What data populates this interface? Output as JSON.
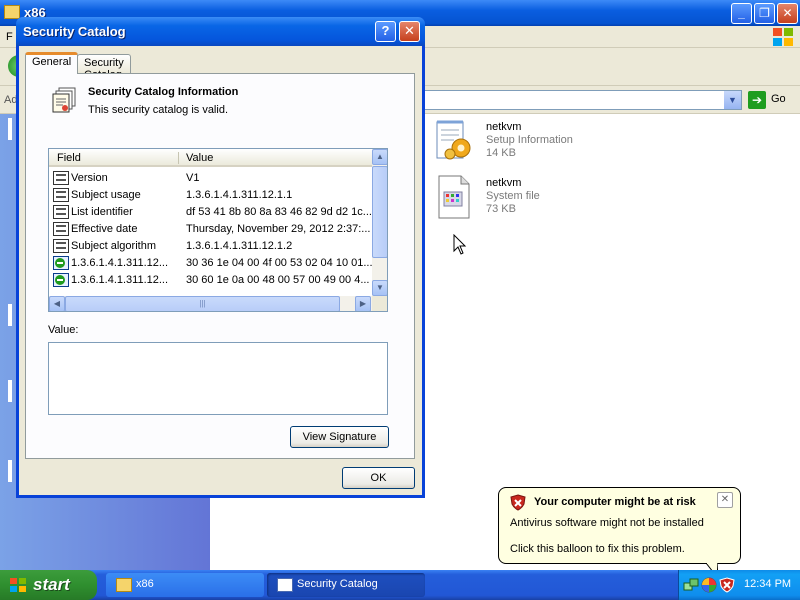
{
  "explorer": {
    "title": "x86",
    "menu_partial": "F",
    "address_partial": "Ad",
    "go_label": "Go",
    "files": [
      {
        "name": "netkvm",
        "type": "Setup Information",
        "size": "14 KB",
        "icon": "setup-information-icon"
      },
      {
        "name": "netkvm",
        "type": "System file",
        "size": "73 KB",
        "icon": "system-file-icon"
      }
    ]
  },
  "dialog": {
    "title": "Security Catalog",
    "help_glyph": "?",
    "close_glyph": "✕",
    "tabs": [
      {
        "label": "General",
        "selected": true
      },
      {
        "label": "Security Catalog",
        "selected": false
      }
    ],
    "info_title": "Security Catalog Information",
    "info_subtitle": "This security catalog is valid.",
    "columns": {
      "field": "Field",
      "value": "Value"
    },
    "rows": [
      {
        "field": "Version",
        "value": "V1",
        "icon": "field-icon"
      },
      {
        "field": "Subject usage",
        "value": "1.3.6.1.4.1.311.12.1.1",
        "icon": "field-icon"
      },
      {
        "field": "List identifier",
        "value": "df 53 41 8b 80 8a 83 46 82 9d d2 1c...",
        "icon": "field-icon"
      },
      {
        "field": "Effective date",
        "value": "Thursday, November 29, 2012 2:37:...",
        "icon": "field-icon"
      },
      {
        "field": "Subject algorithm",
        "value": "1.3.6.1.4.1.311.12.1.2",
        "icon": "field-icon"
      },
      {
        "field": "1.3.6.1.4.1.311.12...",
        "value": "30 36 1e 04 00 4f 00 53 02 04 10 01...",
        "icon": "extension-icon"
      },
      {
        "field": "1.3.6.1.4.1.311.12...",
        "value": "30 60 1e 0a 00 48 00 57 00 49 00 4...",
        "icon": "extension-icon"
      }
    ],
    "value_label": "Value:",
    "value_text": "",
    "view_signature_label": "View Signature",
    "ok_label": "OK"
  },
  "balloon": {
    "title": "Your computer might be at risk",
    "line1": "Antivirus software might not be installed",
    "line2": "Click this balloon to fix this problem.",
    "close_glyph": "✕"
  },
  "taskbar": {
    "start_label": "start",
    "tasks": [
      {
        "label": "x86",
        "active": false
      },
      {
        "label": "Security Catalog",
        "active": true
      }
    ],
    "clock": "12:34 PM"
  },
  "colors": {
    "title_blue": "#0555dc",
    "start_green": "#2f8f2f",
    "tray_blue": "#0f8ded",
    "balloon_bg": "#ffffe1",
    "tab_highlight": "#e68b2c"
  }
}
